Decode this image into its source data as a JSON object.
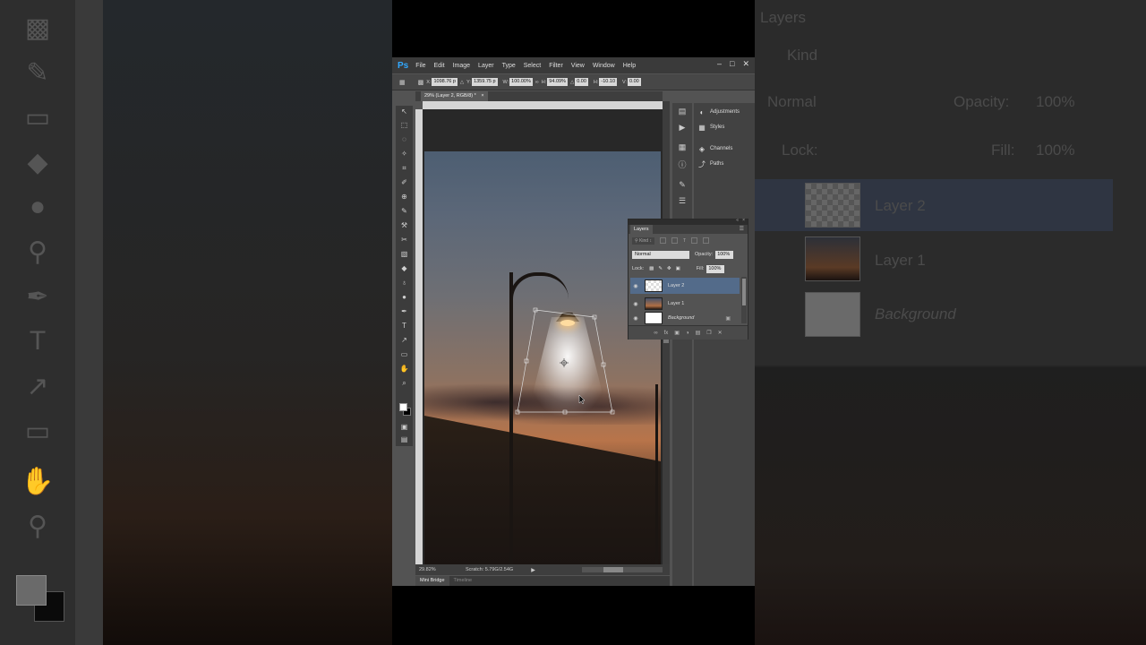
{
  "background": {
    "left_icons": [
      "stamp-icon",
      "brush-icon",
      "eraser-icon",
      "bucket-icon",
      "drop-icon",
      "zoom-icon",
      "pen-icon",
      "text-icon",
      "path-select-icon",
      "rect-icon",
      "hand-icon",
      "magnifier-icon"
    ],
    "right": {
      "layers_title": "Layers",
      "kind_label": "Kind",
      "blend": "Normal",
      "opacity_label": "Opacity:",
      "opacity_value": "100%",
      "lock_label": "Lock:",
      "fill_label": "Fill:",
      "fill_value": "100%",
      "layer2": "Layer 2",
      "layer1": "Layer 1",
      "background_layer": "Background"
    }
  },
  "app": {
    "logo": "Ps",
    "menu": [
      "File",
      "Edit",
      "Image",
      "Layer",
      "Type",
      "Select",
      "Filter",
      "View",
      "Window",
      "Help"
    ],
    "window_controls": [
      "–",
      "□",
      "✕"
    ]
  },
  "options": {
    "x_label": "X:",
    "x_value": "1098.76 p",
    "y_label": "Y:",
    "y_value": "1359.75 p",
    "w_label": "W:",
    "w_value": "100.00%",
    "h_label": "H:",
    "h_value": "94.09%",
    "angle_value": "0.00",
    "hskew_label": "H:",
    "hskew_value": "-10.10",
    "vskew_label": "V:",
    "vskew_value": "0.00"
  },
  "document": {
    "tab_title": "29% (Layer 2, RGB/8) *",
    "close_symbol": "×"
  },
  "tools": [
    "↖",
    "⬚",
    "◌",
    "✧",
    "⌗",
    "✐",
    "⊕",
    "✎",
    "⚒",
    "✂",
    "▧",
    "◆",
    "♁",
    "●",
    "✒",
    "T",
    "↗",
    "▭",
    "✋",
    "⌕"
  ],
  "status": {
    "zoom": "29.82%",
    "scratch": "Scratch: 5.79G/2.54G"
  },
  "bottom_tabs": [
    "Mini Bridge",
    "Timeline"
  ],
  "dock": {
    "items": [
      {
        "icon": "◐",
        "label": "Adjustments"
      },
      {
        "icon": "▦",
        "label": "Styles"
      },
      {
        "icon": "◈",
        "label": "Channels"
      },
      {
        "icon": "⤴",
        "label": "Paths"
      }
    ]
  },
  "layers_panel": {
    "title": "Layers",
    "kind_label": "Kind",
    "blend_mode": "Normal",
    "opacity_label": "Opacity:",
    "opacity_value": "100%",
    "lock_label": "Lock:",
    "fill_label": "Fill:",
    "fill_value": "100%",
    "layers": [
      {
        "name": "Layer 2",
        "selected": true
      },
      {
        "name": "Layer 1",
        "selected": false
      },
      {
        "name": "Background",
        "selected": false
      }
    ],
    "bottom_icons": [
      "∞",
      "fx",
      "▣",
      "◑",
      "▤",
      "❐",
      "✕"
    ]
  },
  "colors": {
    "accent": "#31a8ff",
    "selected_layer": "#536b8a",
    "panel": "#535353"
  }
}
